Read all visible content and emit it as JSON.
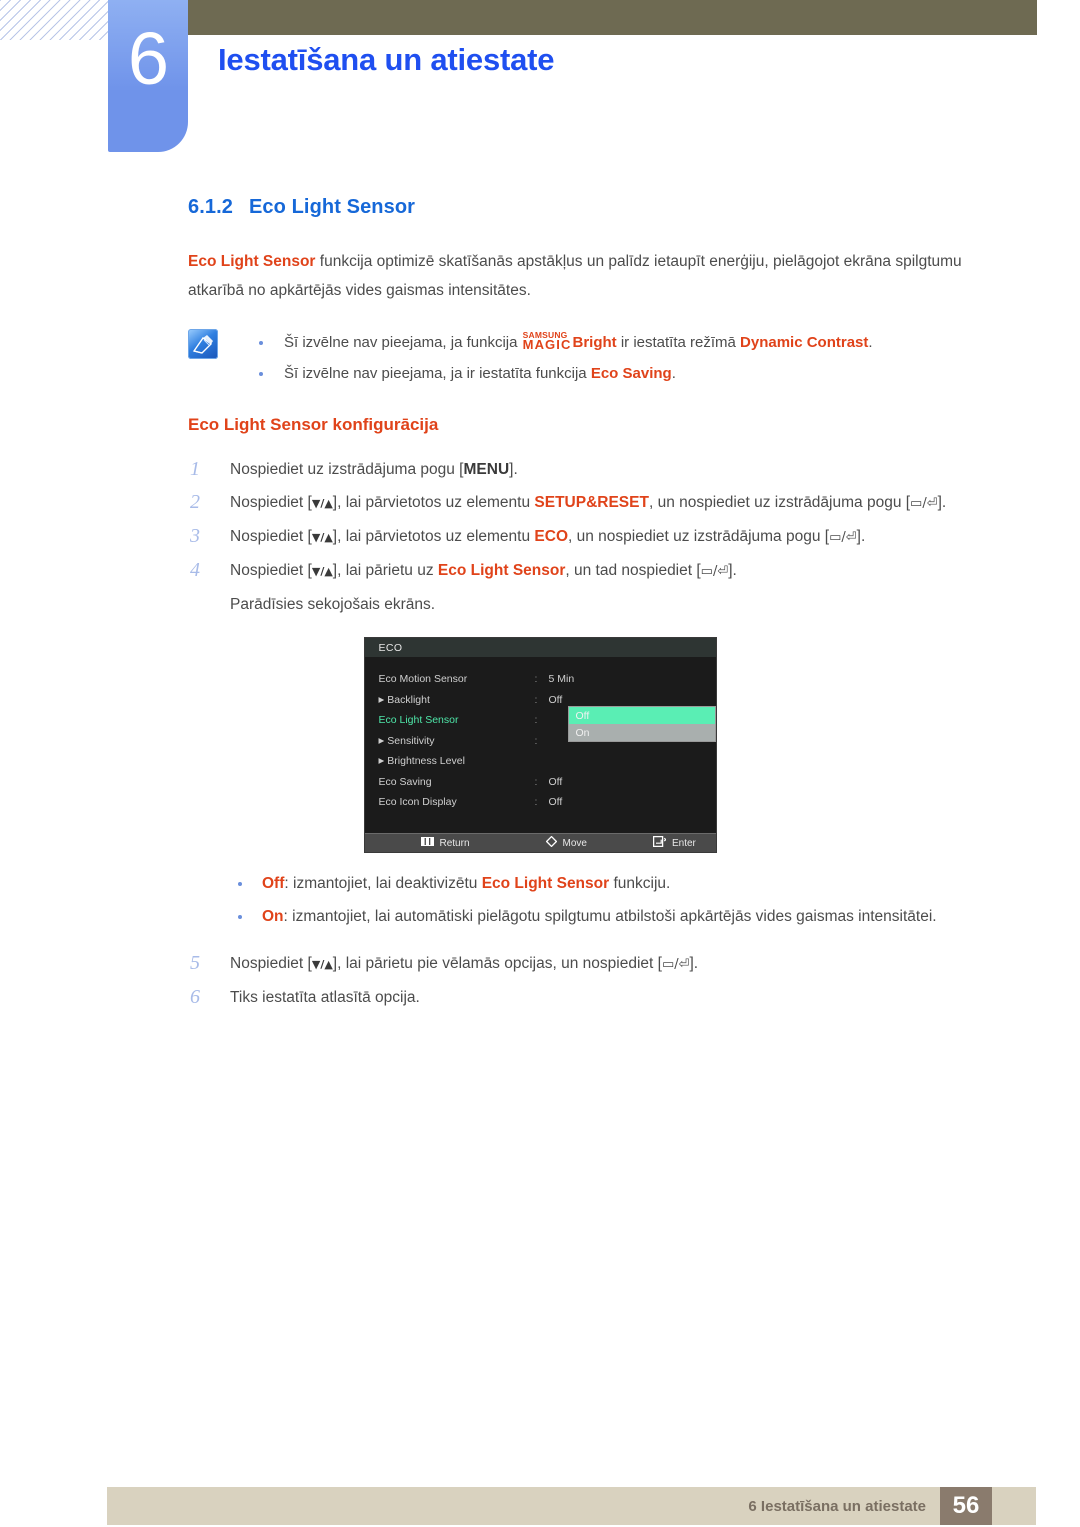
{
  "header": {
    "chapter_number": "6",
    "chapter_title": "Iestatīšana un atiestate"
  },
  "section": {
    "number": "6.1.2",
    "title": "Eco Light Sensor",
    "intro_1": "Eco Light Sensor",
    "intro_2": " funkcija optimizē skatīšanās apstākļus un palīdz ietaupīt enerģiju, pielāgojot ekrāna spilgtumu atkarībā no apkārtējās vides gaismas intensitātes."
  },
  "note": {
    "icon": "note-pencil-icon",
    "items": [
      {
        "pre": "Šī izvēlne nav pieejama, ja funkcija ",
        "magic_top": "SAMSUNG",
        "magic_bottom": "MAGIC",
        "magic_suffix": "Bright",
        "mid": " ir iestatīta režīmā ",
        "hl": "Dynamic Contrast",
        "post": "."
      },
      {
        "pre": "Šī izvēlne nav pieejama, ja ir iestatīta funkcija ",
        "hl": "Eco Saving",
        "post": "."
      }
    ]
  },
  "config": {
    "heading": "Eco Light Sensor konfigurācija",
    "steps": [
      {
        "num": "1",
        "parts": [
          {
            "t": "Nospiediet uz izstrādājuma pogu [",
            "k": "plain"
          },
          {
            "t": "MENU",
            "k": "kw"
          },
          {
            "t": "].",
            "k": "plain"
          }
        ]
      },
      {
        "num": "2",
        "parts": [
          {
            "t": "Nospiediet [",
            "k": "plain"
          },
          {
            "t": "▼/▲",
            "k": "arrows"
          },
          {
            "t": "], lai pārvietotos uz elementu ",
            "k": "plain"
          },
          {
            "t": "SETUP&RESET",
            "k": "hl"
          },
          {
            "t": ", un nospiediet uz izstrādājuma pogu [",
            "k": "plain"
          },
          {
            "t": "▭/⏎",
            "k": "sym"
          },
          {
            "t": "].",
            "k": "plain"
          }
        ]
      },
      {
        "num": "3",
        "parts": [
          {
            "t": "Nospiediet [",
            "k": "plain"
          },
          {
            "t": "▼/▲",
            "k": "arrows"
          },
          {
            "t": "], lai pārvietotos uz elementu ",
            "k": "plain"
          },
          {
            "t": "ECO",
            "k": "hl"
          },
          {
            "t": ", un nospiediet uz izstrādājuma pogu [",
            "k": "plain"
          },
          {
            "t": "▭/⏎",
            "k": "sym"
          },
          {
            "t": "].",
            "k": "plain"
          }
        ]
      },
      {
        "num": "4",
        "parts": [
          {
            "t": "Nospiediet [",
            "k": "plain"
          },
          {
            "t": "▼/▲",
            "k": "arrows"
          },
          {
            "t": "], lai pārietu uz ",
            "k": "plain"
          },
          {
            "t": "Eco Light Sensor",
            "k": "hl"
          },
          {
            "t": ", un tad nospiediet [",
            "k": "plain"
          },
          {
            "t": "▭/⏎",
            "k": "sym"
          },
          {
            "t": "].",
            "k": "plain"
          }
        ],
        "sub": "Parādīsies sekojošais ekrāns."
      }
    ],
    "steps_after": [
      {
        "num": "5",
        "parts": [
          {
            "t": "Nospiediet [",
            "k": "plain"
          },
          {
            "t": "▼/▲",
            "k": "arrows"
          },
          {
            "t": "], lai pārietu pie vēlamās opcijas, un nospiediet [",
            "k": "plain"
          },
          {
            "t": "▭/⏎",
            "k": "sym"
          },
          {
            "t": "].",
            "k": "plain"
          }
        ]
      },
      {
        "num": "6",
        "parts": [
          {
            "t": "Tiks iestatīta atlasītā opcija.",
            "k": "plain"
          }
        ]
      }
    ]
  },
  "osd": {
    "title": "ECO",
    "rows": [
      {
        "label": "Eco Motion Sensor",
        "arrow": false,
        "selected": false,
        "colon": ":",
        "value": "5 Min"
      },
      {
        "label": "Backlight",
        "arrow": true,
        "selected": false,
        "colon": ":",
        "value": "Off"
      },
      {
        "label": "Eco Light Sensor",
        "arrow": false,
        "selected": true,
        "colon": ":",
        "value": ""
      },
      {
        "label": "Sensitivity",
        "arrow": true,
        "selected": false,
        "colon": ":",
        "value": ""
      },
      {
        "label": "Brightness Level",
        "arrow": true,
        "selected": false,
        "colon": "",
        "value": ""
      },
      {
        "label": "Eco Saving",
        "arrow": false,
        "selected": false,
        "colon": ":",
        "value": "Off"
      },
      {
        "label": "Eco Icon Display",
        "arrow": false,
        "selected": false,
        "colon": ":",
        "value": "Off"
      }
    ],
    "dropdown": {
      "highlighted": "Off",
      "other": "On"
    },
    "footer": [
      {
        "icon": "menu-bars-icon",
        "label": "Return"
      },
      {
        "icon": "diamond-move-icon",
        "label": "Move"
      },
      {
        "icon": "enter-key-icon",
        "label": "Enter"
      }
    ],
    "colors": {
      "background": "#1b1b1b",
      "title_bar": "#2e3533",
      "selected_text": "#4ee6a8",
      "highlight": "#5aeeb4",
      "dropdown_bg": "#a9afae",
      "footer_bar": "#4a4a4a"
    }
  },
  "options": [
    {
      "name": "Off",
      "pre": ": izmantojiet, lai deaktivizētu ",
      "hl": "Eco Light Sensor",
      "post": " funkciju."
    },
    {
      "name": "On",
      "pre": ": izmantojiet, lai automātiski pielāgotu spilgtumu atbilstoši apkārtējās vides gaismas intensitātei.",
      "hl": "",
      "post": ""
    }
  ],
  "footer": {
    "text": "6 Iestatīšana un atiestate",
    "page": "56"
  },
  "colors": {
    "accent_blue": "#1f4ff0",
    "section_blue": "#1668d8",
    "orange": "#e0431a",
    "olive": "#6e6a52",
    "tab_blue": "#6f93ea",
    "footer_bar": "#d9d2bf",
    "footer_page": "#8a7b6d"
  }
}
